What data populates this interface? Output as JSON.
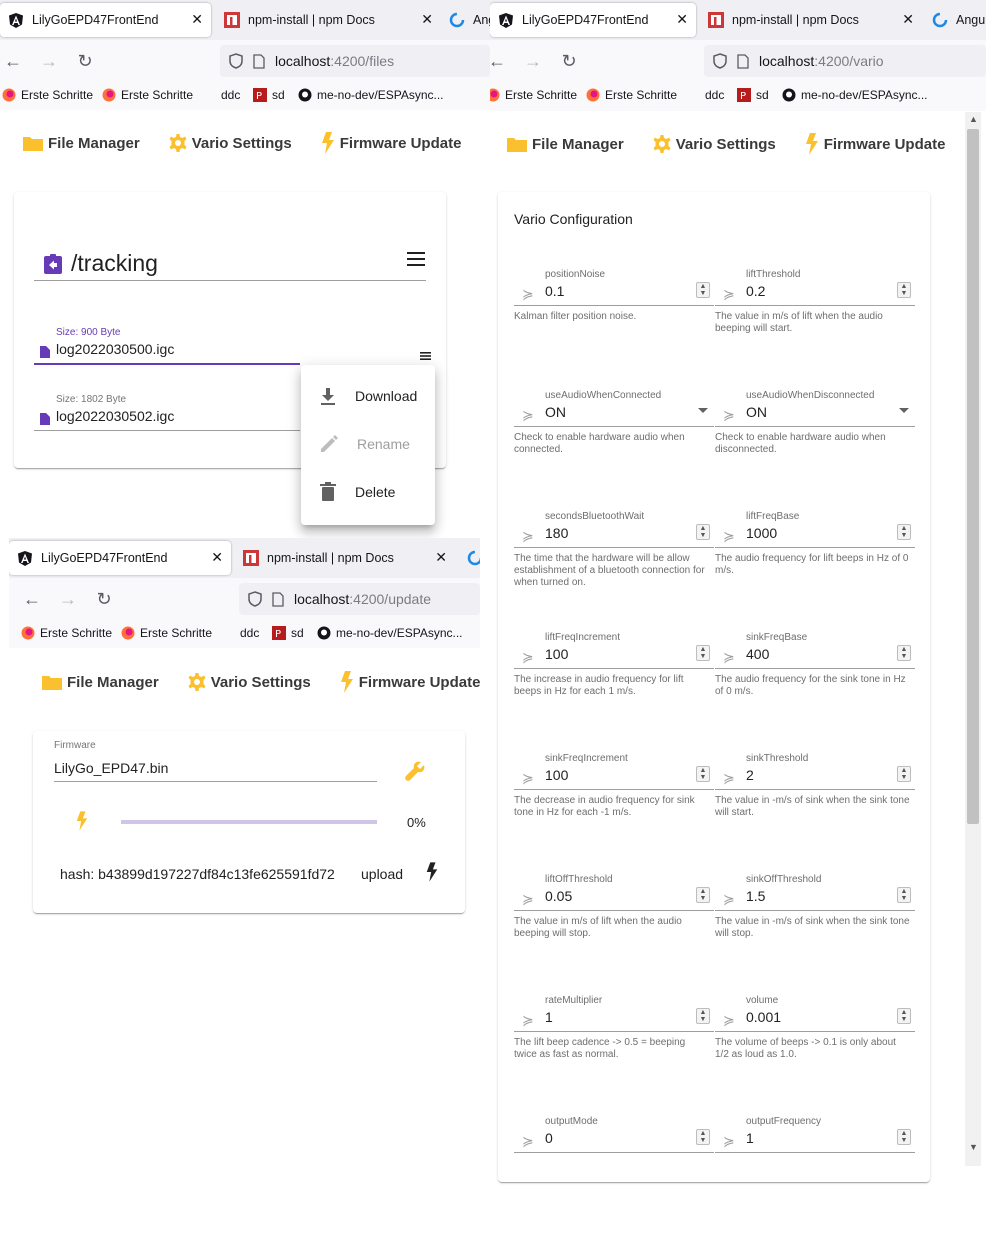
{
  "windows": {
    "files": {
      "tabs": [
        {
          "label": "LilyGoEPD47FrontEnd",
          "icon": "angular-icon"
        },
        {
          "label": "npm-install | npm Docs",
          "icon": "npm-icon"
        },
        {
          "label": "Ang",
          "icon": "loader-icon"
        }
      ],
      "url_host": "localhost",
      "url_path": ":4200/files",
      "bookmarks": [
        "Erste Schritte",
        "Erste Schritte",
        "ddc",
        "sd",
        "me-no-dev/ESPAsync..."
      ]
    },
    "vario": {
      "tabs": [
        {
          "label": "LilyGoEPD47FrontEnd",
          "icon": "angular-icon"
        },
        {
          "label": "npm-install | npm Docs",
          "icon": "npm-icon"
        },
        {
          "label": "Angu",
          "icon": "loader-icon"
        }
      ],
      "url_host": "localhost",
      "url_path": ":4200/vario",
      "bookmarks": [
        "Erste Schritte",
        "Erste Schritte",
        "ddc",
        "sd",
        "me-no-dev/ESPAsync..."
      ]
    },
    "update": {
      "tabs": [
        {
          "label": "LilyGoEPD47FrontEnd",
          "icon": "angular-icon"
        },
        {
          "label": "npm-install | npm Docs",
          "icon": "npm-icon"
        },
        {
          "label": "",
          "icon": "loader-icon"
        }
      ],
      "url_host": "localhost",
      "url_path": ":4200/update",
      "bookmarks": [
        "Erste Schritte",
        "Erste Schritte",
        "ddc",
        "sd",
        "me-no-dev/ESPAsync..."
      ]
    }
  },
  "app_nav": {
    "file_manager": "File Manager",
    "vario_settings": "Vario Settings",
    "firmware_update": "Firmware Update"
  },
  "file_manager": {
    "path": "/tracking",
    "files": [
      {
        "size": "Size: 900 Byte",
        "name": "log2022030500.igc",
        "selected": true
      },
      {
        "size": "Size: 1802 Byte",
        "name": "log2022030502.igc",
        "selected": false
      }
    ],
    "menu": [
      {
        "label": "Download",
        "icon": "download-icon",
        "enabled": true
      },
      {
        "label": "Rename",
        "icon": "edit-icon",
        "enabled": false
      },
      {
        "label": "Delete",
        "icon": "delete-icon",
        "enabled": true
      }
    ]
  },
  "vario": {
    "title": "Vario Configuration",
    "prefix": "≽",
    "fields": [
      {
        "label": "positionNoise",
        "value": "0.1",
        "kind": "number",
        "hint": "Kalman filter position noise."
      },
      {
        "label": "liftThreshold",
        "value": "0.2",
        "kind": "number",
        "hint": "The value in m/s of lift when the audio beeping will start."
      },
      {
        "label": "useAudioWhenConnected",
        "value": "ON",
        "kind": "select",
        "hint": "Check to enable hardware audio when connected."
      },
      {
        "label": "useAudioWhenDisconnected",
        "value": "ON",
        "kind": "select",
        "hint": "Check to enable hardware audio when disconnected."
      },
      {
        "label": "secondsBluetoothWait",
        "value": "180",
        "kind": "number",
        "hint": "The time that the hardware will be allow establishment of a bluetooth connection for when turned on."
      },
      {
        "label": "liftFreqBase",
        "value": "1000",
        "kind": "number",
        "hint": "The audio frequency for lift beeps in Hz of 0 m/s."
      },
      {
        "label": "liftFreqIncrement",
        "value": "100",
        "kind": "number",
        "hint": "The increase in audio frequency for lift beeps in Hz for each 1 m/s."
      },
      {
        "label": "sinkFreqBase",
        "value": "400",
        "kind": "number",
        "hint": "The audio frequency for the sink tone in Hz of 0 m/s."
      },
      {
        "label": "sinkFreqIncrement",
        "value": "100",
        "kind": "number",
        "hint": "The decrease in audio frequency for sink tone in Hz for each -1 m/s."
      },
      {
        "label": "sinkThreshold",
        "value": "2",
        "kind": "number",
        "hint": "The value in -m/s of sink when the sink tone will start."
      },
      {
        "label": "liftOffThreshold",
        "value": "0.05",
        "kind": "number",
        "hint": "The value in m/s of lift when the audio beeping will stop."
      },
      {
        "label": "sinkOffThreshold",
        "value": "1.5",
        "kind": "number",
        "hint": "The value in -m/s of sink when the sink tone will stop."
      },
      {
        "label": "rateMultiplier",
        "value": "1",
        "kind": "number",
        "hint": "The lift beep cadence -> 0.5 = beeping twice as fast as normal."
      },
      {
        "label": "volume",
        "value": "0.001",
        "kind": "number",
        "hint": "The volume of beeps -> 0.1 is only about 1/2 as loud as 1.0."
      },
      {
        "label": "outputMode",
        "value": "0",
        "kind": "number",
        "hint": ""
      },
      {
        "label": "outputFrequency",
        "value": "1",
        "kind": "number",
        "hint": ""
      }
    ]
  },
  "update": {
    "field_label": "Firmware",
    "file": "LilyGo_EPD47.bin",
    "progress_percent": 0,
    "progress_text": "0%",
    "hash": "hash: b43899d197227df84c13fe625591fd72",
    "upload_label": "upload"
  },
  "colors": {
    "accent": "#673ab7",
    "folder": "#fbc02d",
    "gear": "#fbc02d",
    "bolt": "#fbc02d"
  }
}
